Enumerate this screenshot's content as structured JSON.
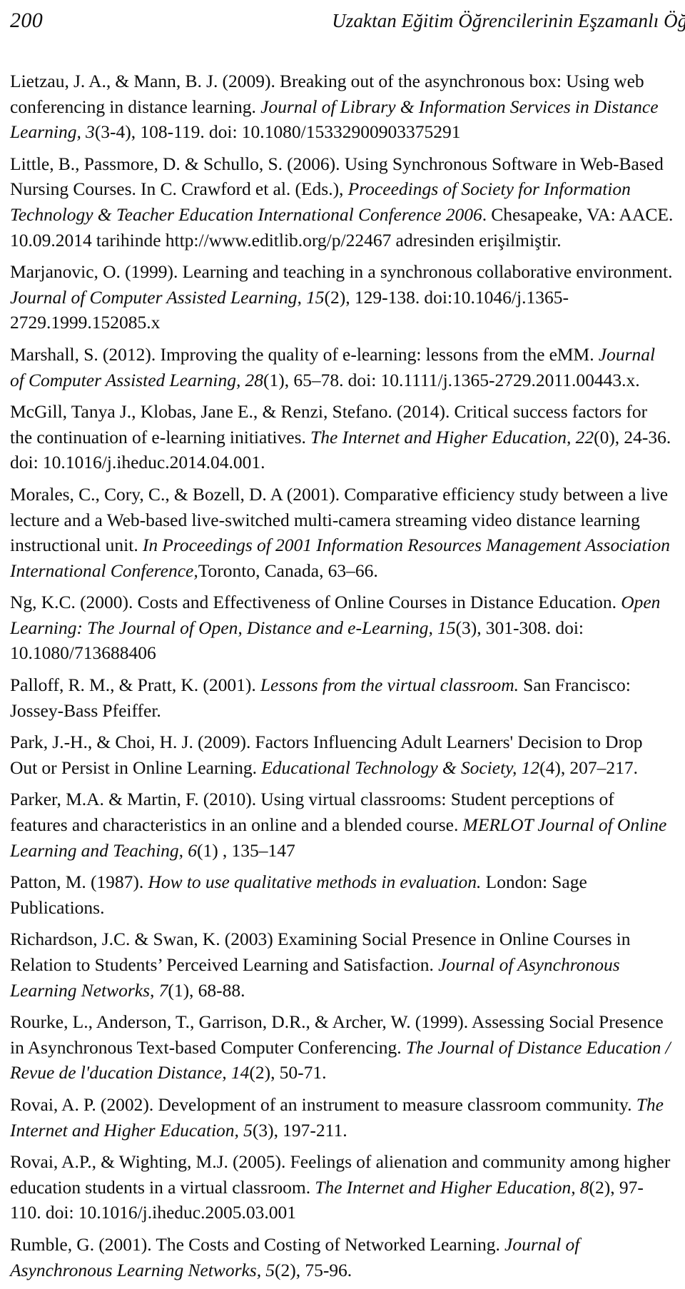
{
  "header": {
    "page_number": "200",
    "title": "Uzaktan Eğitim Öğrencilerinin Eşzamanlı Öğrenme …"
  },
  "references": [
    {
      "id": "lietzau-mann-2009",
      "segments": [
        {
          "text": "Lietzau, J. A., & Mann, B. J. (2009). Breaking out of the asynchronous box: Using web conferencing in distance learning. ",
          "style": "roman"
        },
        {
          "text": "Journal of Library & Information Services in Distance Learning, 3",
          "style": "italic"
        },
        {
          "text": "(3-4), 108-119. doi: 10.1080/15332900903375291",
          "style": "roman"
        }
      ]
    },
    {
      "id": "little-passmore-schullo-2006",
      "segments": [
        {
          "text": "Little, B., Passmore, D. & Schullo, S. (2006). Using Synchronous Software in Web-Based Nursing Courses. In C. Crawford et al. (Eds.), ",
          "style": "roman"
        },
        {
          "text": "Proceedings of Society for Information Technology & Teacher Education International Conference 2006",
          "style": "italic"
        },
        {
          "text": ". Chesapeake, VA: AACE. 10.09.2014 tarihinde http://www.editlib.org/p/22467 adresinden erişilmiştir.",
          "style": "roman"
        }
      ]
    },
    {
      "id": "marjanovic-1999",
      "segments": [
        {
          "text": "Marjanovic, O. (1999). Learning and teaching in a synchronous collaborative environment. ",
          "style": "roman"
        },
        {
          "text": "Journal of Computer Assisted Learning, 15",
          "style": "italic"
        },
        {
          "text": "(2), 129-138. doi:10.1046/j.1365-2729.1999.152085.x",
          "style": "roman"
        }
      ]
    },
    {
      "id": "marshall-2012",
      "segments": [
        {
          "text": "Marshall, S. (2012). Improving the quality of e-learning: lessons from the eMM. ",
          "style": "roman"
        },
        {
          "text": "Journal of Computer Assisted Learning, 28",
          "style": "italic"
        },
        {
          "text": "(1), 65–78. doi: 10.1111/j.1365-2729.2011.00443.x.",
          "style": "roman"
        }
      ]
    },
    {
      "id": "mcgill-klobas-renzi-2014",
      "segments": [
        {
          "text": "McGill, Tanya J., Klobas, Jane E., & Renzi, Stefano. (2014). Critical success factors for the continuation of e-learning initiatives. ",
          "style": "roman"
        },
        {
          "text": "The Internet and Higher Education, 22",
          "style": "italic"
        },
        {
          "text": "(0), 24-36. doi: 10.1016/j.iheduc.2014.04.001.",
          "style": "roman"
        }
      ]
    },
    {
      "id": "morales-cory-bozell-2001",
      "segments": [
        {
          "text": "Morales, C., Cory, C., & Bozell, D. A (2001). Comparative efficiency study between a live lecture and a Web-based live-switched multi-camera streaming video distance learning instructional unit. ",
          "style": "roman"
        },
        {
          "text": "In Proceedings of 2001 Information Resources Management Association International Conference,",
          "style": "italic"
        },
        {
          "text": "Toronto, Canada, 63–66.",
          "style": "roman"
        }
      ]
    },
    {
      "id": "ng-2000",
      "segments": [
        {
          "text": "Ng, K.C. (2000). Costs and Effectiveness of Online Courses in Distance Education. ",
          "style": "roman"
        },
        {
          "text": "Open Learning: The Journal of Open, Distance and e-Learning, 15",
          "style": "italic"
        },
        {
          "text": "(3), 301-308. doi: 10.1080/713688406",
          "style": "roman"
        }
      ]
    },
    {
      "id": "palloff-pratt-2001",
      "segments": [
        {
          "text": "Palloff, R. M., & Pratt, K. (2001). ",
          "style": "roman"
        },
        {
          "text": "Lessons from the virtual classroom.",
          "style": "italic"
        },
        {
          "text": " San Francisco: Jossey-Bass Pfeiffer.",
          "style": "roman"
        }
      ]
    },
    {
      "id": "park-choi-2009",
      "segments": [
        {
          "text": "Park, J.-H., & Choi, H. J. (2009). Factors Influencing Adult Learners' Decision to Drop Out or Persist in Online Learning. ",
          "style": "roman"
        },
        {
          "text": "Educational Technology & Society, 12",
          "style": "italic"
        },
        {
          "text": "(4), 207–217.",
          "style": "roman"
        }
      ]
    },
    {
      "id": "parker-martin-2010",
      "segments": [
        {
          "text": "Parker, M.A. & Martin, F. (2010). Using virtual classrooms: Student perceptions of features and characteristics in an online and a blended course. ",
          "style": "roman"
        },
        {
          "text": "MERLOT Journal of Online Learning and Teaching, 6",
          "style": "italic"
        },
        {
          "text": "(1) , 135–147",
          "style": "roman"
        }
      ]
    },
    {
      "id": "patton-1987",
      "segments": [
        {
          "text": "Patton, M. (1987).  ",
          "style": "roman"
        },
        {
          "text": "How to use qualitative methods in evaluation.",
          "style": "italic"
        },
        {
          "text": " London: Sage Publications.",
          "style": "roman"
        }
      ]
    },
    {
      "id": "richardson-swan-2003",
      "segments": [
        {
          "text": "Richardson, J.C. & Swan, K. (2003) Examining Social Presence in Online Courses in Relation to Students’ Perceived Learning and Satisfaction. ",
          "style": "roman"
        },
        {
          "text": "Journal of Asynchronous Learning Networks, 7",
          "style": "italic"
        },
        {
          "text": "(1), 68-88.",
          "style": "roman"
        }
      ]
    },
    {
      "id": "rourke-anderson-garrison-archer-1999",
      "segments": [
        {
          "text": "Rourke, L., Anderson, T., Garrison, D.R., & Archer, W. (1999). Assessing Social Presence in Asynchronous Text-based Computer Conferencing. ",
          "style": "roman"
        },
        {
          "text": "The Journal of Distance Education / Revue de l'ducation Distance, 14",
          "style": "italic"
        },
        {
          "text": "(2), 50-71.",
          "style": "roman"
        }
      ]
    },
    {
      "id": "rovai-2002",
      "segments": [
        {
          "text": "Rovai, A. P. (2002). Development of an instrument to measure classroom community. ",
          "style": "roman"
        },
        {
          "text": "The Internet and Higher Education, 5",
          "style": "italic"
        },
        {
          "text": "(3), 197-211.",
          "style": "roman"
        }
      ]
    },
    {
      "id": "rovai-wighting-2005",
      "segments": [
        {
          "text": "Rovai, A.P., & Wighting, M.J. (2005). Feelings of alienation and community among higher education students in a virtual classroom. ",
          "style": "roman"
        },
        {
          "text": "The Internet and Higher Education, 8",
          "style": "italic"
        },
        {
          "text": "(2), 97-110. doi: 10.1016/j.iheduc.2005.03.001",
          "style": "roman"
        }
      ]
    },
    {
      "id": "rumble-2001",
      "segments": [
        {
          "text": "Rumble, G. (2001). The Costs and Costing of Networked Learning. ",
          "style": "roman"
        },
        {
          "text": "Journal of Asynchronous Learning Networks, 5",
          "style": "italic"
        },
        {
          "text": "(2), 75-96.",
          "style": "roman"
        }
      ]
    }
  ]
}
